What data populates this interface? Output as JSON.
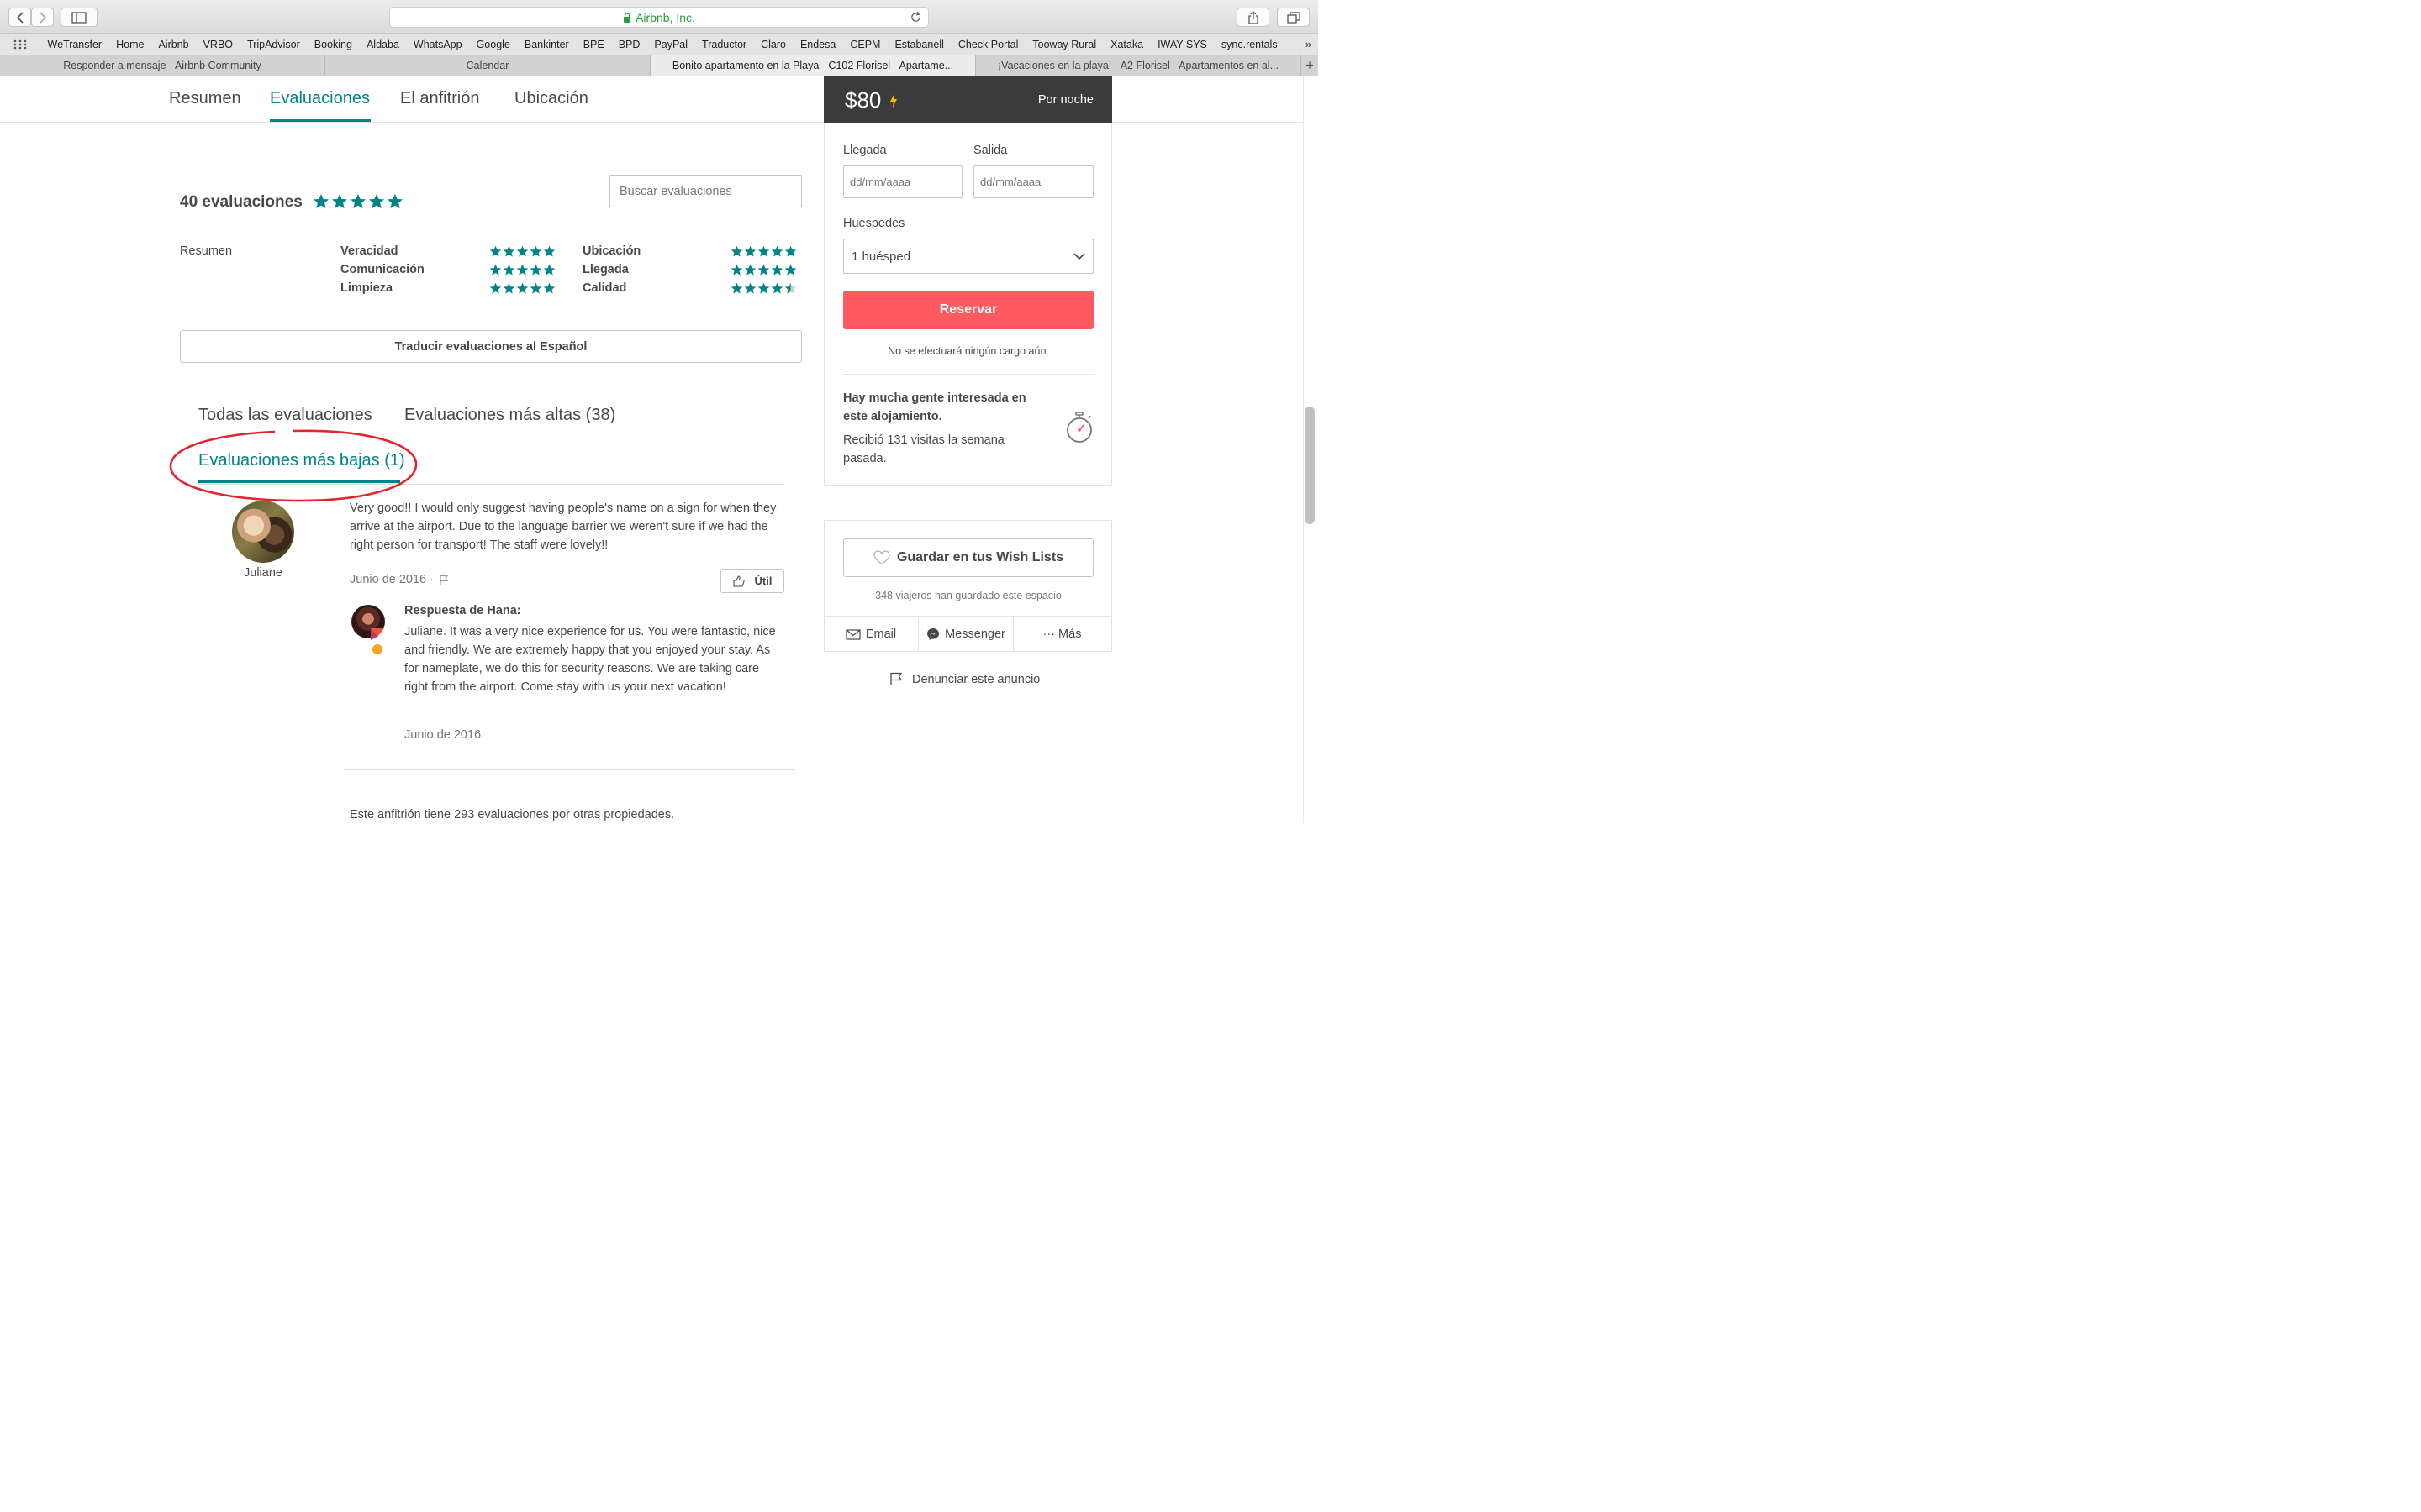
{
  "browser": {
    "url": "Airbnb, Inc.",
    "bookmarks": [
      "WeTransfer",
      "Home",
      "Airbnb",
      "VRBO",
      "TripAdvisor",
      "Booking",
      "Aldaba",
      "WhatsApp",
      "Google",
      "Bankinter",
      "BPE",
      "BPD",
      "PayPal",
      "Traductor",
      "Claro",
      "Endesa",
      "CEPM",
      "Estabanell",
      "Check Portal",
      "Tooway Rural",
      "Xataka",
      "IWAY SYS",
      "sync.rentals"
    ],
    "bookmarks_more": "»",
    "tabs": [
      {
        "title": "Responder a mensaje - Airbnb Community"
      },
      {
        "title": "Calendar"
      },
      {
        "title": "Bonito apartamento en la Playa - C102 Florisel - Apartame..."
      },
      {
        "title": "¡Vacaciones en la playa! - A2 Florisel - Apartamentos en al..."
      }
    ],
    "new_tab": "+"
  },
  "nav": {
    "tabs": [
      "Resumen",
      "Evaluaciones",
      "El anfitrión",
      "Ubicación"
    ],
    "active": "Evaluaciones"
  },
  "reviews": {
    "count_label": "40 evaluaciones",
    "overall_rating": 5,
    "search_placeholder": "Buscar evaluaciones",
    "summary_label": "Resumen",
    "categories": [
      {
        "name": "Veracidad",
        "rating": 5
      },
      {
        "name": "Comunicación",
        "rating": 5
      },
      {
        "name": "Limpieza",
        "rating": 5
      },
      {
        "name": "Ubicación",
        "rating": 5
      },
      {
        "name": "Llegada",
        "rating": 5
      },
      {
        "name": "Calidad",
        "rating": 4.5
      }
    ],
    "translate_label": "Traducir evaluaciones al Español",
    "filters": [
      "Todas las evaluaciones",
      "Evaluaciones más altas (38)",
      "Evaluaciones más bajas (1)"
    ],
    "active_filter": "Evaluaciones más bajas (1)",
    "items": [
      {
        "reviewer": "Juliane",
        "text": "Very good!! I would only suggest having people's name on a sign for when they arrive at the airport. Due to the language barrier we weren't sure if we had the right person for transport! The staff were lovely!!",
        "date": "Junio de 2016 ·",
        "useful_label": "Útil",
        "response_title": "Respuesta de Hana:",
        "response_text": "Juliane. It was a very nice experience for us. You were fantastic, nice and friendly. We are extremely happy that you enjoyed your stay. As for nameplate, we do this for security reasons. We are taking care right from the airport.  Come stay with us your next vacation!",
        "response_date": "Junio de 2016"
      }
    ],
    "other_properties": "Este anfitrión tiene 293 evaluaciones por otras propiedades."
  },
  "booking": {
    "price": "$80",
    "per_night": "Por noche",
    "checkin_label": "Llegada",
    "checkout_label": "Salida",
    "date_placeholder": "dd/mm/aaaa",
    "guests_label": "Huéspedes",
    "guests_value": "1 huésped",
    "reserve_label": "Reservar",
    "no_charge": "No se efectuará ningún cargo aún.",
    "interest_title": "Hay mucha gente interesada en este alojamiento.",
    "interest_text": "Recibió 131 visitas la semana pasada.",
    "wishlist_label": "Guardar en tus Wish Lists",
    "wishlist_count": "348 viajeros han guardado este espacio",
    "share": [
      "Email",
      "Messenger",
      "··· Más"
    ],
    "report_label": "Denunciar este anuncio"
  },
  "colors": {
    "accent": "#008489",
    "reserve": "#ff5a5f",
    "price_header": "#3b3b3b",
    "annotation_circle": "#e0272f"
  }
}
